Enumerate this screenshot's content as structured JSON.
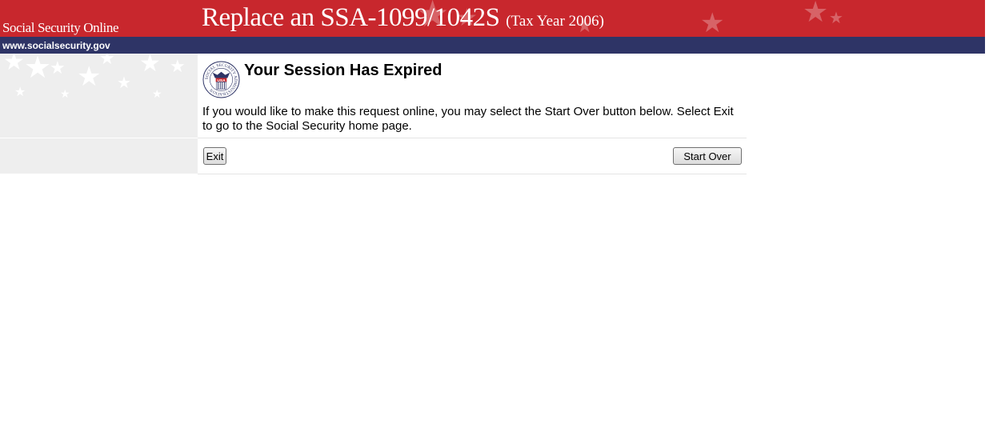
{
  "header": {
    "site_name": "Social Security Online",
    "title": "Replace an SSA-1099/1042S",
    "title_suffix": "(Tax Year 2006)",
    "url": "www.socialsecurity.gov"
  },
  "seal": {
    "ring_text": "SOCIAL SECURITY ADMINISTRATION",
    "center_text": "USA"
  },
  "message": {
    "heading": "Your Session Has Expired",
    "body": "If you would like to make this request online, you may select the Start Over button below. Select Exit to go to the Social Security home page."
  },
  "buttons": {
    "exit": "Exit",
    "start_over": "Start Over"
  },
  "colors": {
    "banner_red": "#c8272d",
    "navy": "#2e3466",
    "sidebar_gray": "#eeeeee"
  }
}
